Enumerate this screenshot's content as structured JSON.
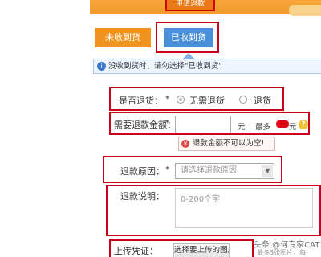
{
  "header": {
    "active_tab_label": "申请退款"
  },
  "tabs": [
    {
      "label": "未收到货",
      "color": "#f0941f"
    },
    {
      "label": "已收到货",
      "color": "#4a8fd9"
    }
  ],
  "notice": {
    "icon": "info-icon",
    "text": "没收到货时，请勿选择\"已收到货\""
  },
  "form": {
    "return_goods": {
      "label": "是否退货：",
      "required": "*",
      "options": [
        "无需退货",
        "退货"
      ],
      "selected": "无需退货"
    },
    "refund_amount": {
      "label": "需要退款金额：",
      "required": "*",
      "value": "",
      "unit": "元",
      "max_prefix": "最多",
      "max_suffix": "元",
      "help_icon": "?"
    },
    "error": {
      "icon": "error-x-icon",
      "text": "退款金额不可以为空!"
    },
    "refund_reason": {
      "label": "退款原因：",
      "required": "*",
      "placeholder": "请选择退款原因"
    },
    "refund_desc": {
      "label": "退款说明：",
      "placeholder": "0-200个字"
    },
    "upload": {
      "label": "上传凭证：",
      "button_label": "选择要上传的图片"
    }
  },
  "watermark": {
    "line1": "头条 @何专家CAT",
    "line2": "最多3张图片，每"
  },
  "colors": {
    "highlight_border": "#c8001a",
    "orange": "#f0941f",
    "blue": "#4a8fd9"
  }
}
